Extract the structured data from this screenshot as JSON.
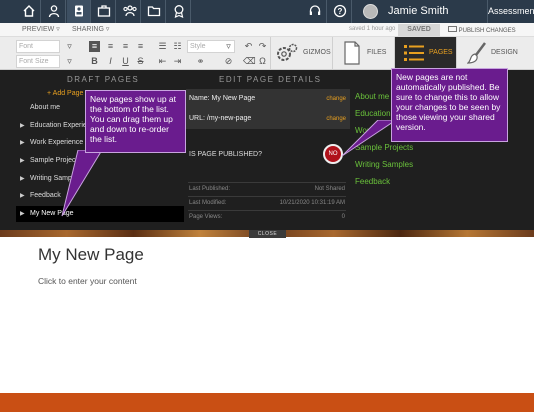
{
  "topnav": {
    "icons": [
      "home-icon",
      "user-icon",
      "portfolio-icon",
      "briefcase-icon",
      "people-icon",
      "folder-icon",
      "badge-icon"
    ],
    "user_name": "Jamie Smith",
    "assessment": "Assessment"
  },
  "preview_bar": {
    "preview": "PREVIEW",
    "sharing": "SHARING",
    "saved_time": "saved 1 hour ago",
    "saved_badge": "SAVED",
    "publish": "PUBLISH CHANGES"
  },
  "toolbar": {
    "font_placeholder": "Font",
    "font_size_placeholder": "Font Size",
    "style_placeholder": "Style",
    "gizmos": "GIZMOS",
    "files": "FILES",
    "pages": "PAGES",
    "design": "DESIGN"
  },
  "panel": {
    "draft_pages_header": "DRAFT PAGES",
    "edit_details_header": "EDIT PAGE DETAILS",
    "add_page": "+ Add Page",
    "pages": [
      "About me",
      "Education Experience",
      "Work Experience",
      "Sample Projects",
      "Writing Samples",
      "Feedback",
      "My New Page"
    ],
    "name_row": "Name: My New Page",
    "url_row": "URL: /my-new-page",
    "change": "change",
    "published_question": "IS PAGE PUBLISHED?",
    "no": "NO",
    "last_published_label": "Last Published:",
    "last_published_value": "Not Shared",
    "last_modified_label": "Last Modified:",
    "last_modified_value": "10/21/2020 10:31:19 AM",
    "page_views_label": "Page Views:",
    "page_views_value": "0",
    "nav_items": [
      "About me",
      "Education",
      "Work",
      "Sample Projects",
      "Writing Samples",
      "Feedback"
    ]
  },
  "tooltips": {
    "left": "New pages show up at the bottom of the list.  You can drag them up and down to re-order the list.",
    "right": "New pages are not automatically published. Be sure to change this to allow your changes to be seen by those viewing your shared version."
  },
  "close": "CLOSE",
  "content": {
    "title": "My New Page",
    "subtitle": "Click to enter your content"
  },
  "colors": {
    "nav_bg": "#2b3a4a",
    "accent_orange": "#e8a020",
    "nav_green": "#6ac13b",
    "tooltip_purple": "#6a1c8e",
    "footer": "#c94f14"
  }
}
